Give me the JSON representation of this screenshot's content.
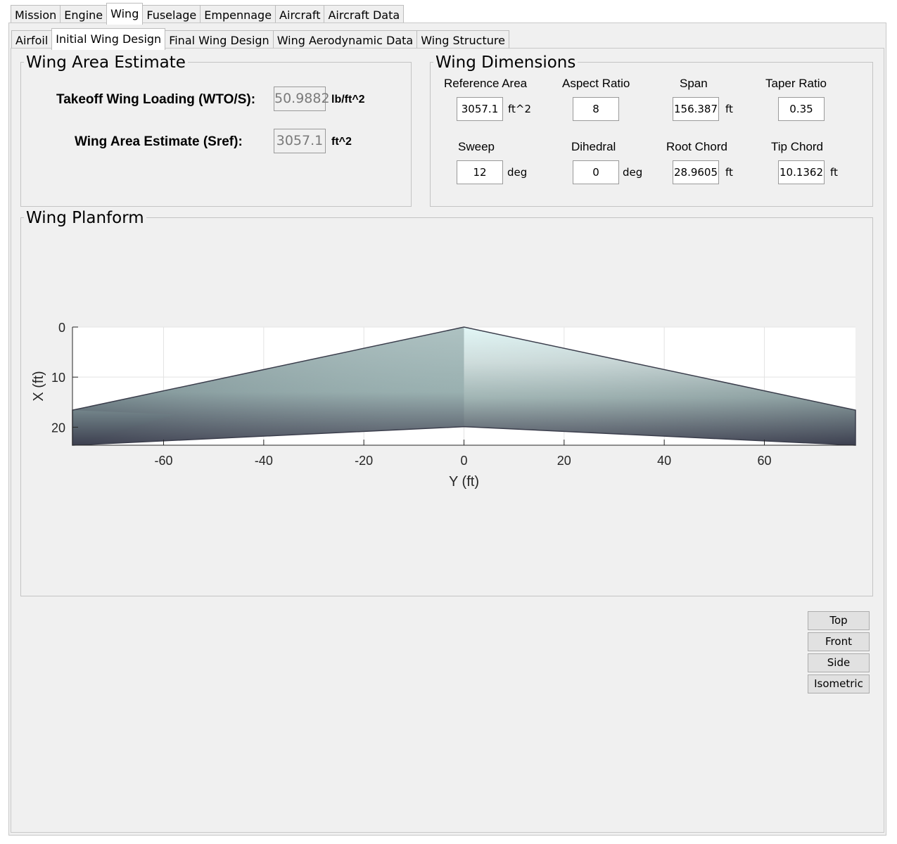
{
  "main_tabs": [
    "Mission",
    "Engine",
    "Wing",
    "Fuselage",
    "Empennage",
    "Aircraft",
    "Aircraft Data"
  ],
  "main_active": "Wing",
  "sub_tabs": [
    "Airfoil",
    "Initial Wing Design",
    "Final Wing Design",
    "Wing Aerodynamic Data",
    "Wing Structure"
  ],
  "sub_active": "Initial Wing Design",
  "area_estimate": {
    "title": "Wing Area Estimate",
    "loading_label": "Takeoff Wing Loading (WTO/S):",
    "loading_value": "50.9882",
    "loading_unit": "lb/ft^2",
    "sref_label": "Wing Area Estimate (Sref):",
    "sref_value": "3057.1",
    "sref_unit": "ft^2"
  },
  "dimensions": {
    "title": "Wing Dimensions",
    "reference_area": {
      "label": "Reference Area",
      "value": "3057.1",
      "unit": "ft^2"
    },
    "aspect_ratio": {
      "label": "Aspect Ratio",
      "value": "8"
    },
    "span": {
      "label": "Span",
      "value": "156.387",
      "unit": "ft"
    },
    "taper_ratio": {
      "label": "Taper Ratio",
      "value": "0.35"
    },
    "sweep": {
      "label": "Sweep",
      "value": "12",
      "unit": "deg"
    },
    "dihedral": {
      "label": "Dihedral",
      "value": "0",
      "unit": "deg"
    },
    "root_chord": {
      "label": "Root Chord",
      "value": "28.9605",
      "unit": "ft"
    },
    "tip_chord": {
      "label": "Tip Chord",
      "value": "10.1362",
      "unit": "ft"
    }
  },
  "planform": {
    "title": "Wing Planform"
  },
  "view_buttons": {
    "top": "Top",
    "front": "Front",
    "side": "Side",
    "isometric": "Isometric"
  },
  "chart_data": {
    "type": "area",
    "title": "",
    "xlabel": "Y (ft)",
    "ylabel": "X (ft)",
    "xlim": [
      -78.2,
      78.2
    ],
    "ylim": [
      0,
      23.6
    ],
    "y_reversed": true,
    "grid": true,
    "xticks": [
      -60,
      -40,
      -20,
      0,
      20,
      40,
      60
    ],
    "yticks": [
      0,
      10,
      20
    ],
    "xtick_labels": [
      "-60",
      "-40",
      "-20",
      "0",
      "20",
      "40",
      "60"
    ],
    "ytick_labels": [
      "0",
      "10",
      "20"
    ],
    "leading_edge": {
      "x": [
        -78.2,
        0,
        78.2
      ],
      "y": [
        16.6,
        0,
        16.6
      ]
    },
    "trailing_edge": {
      "x": [
        -78.2,
        0,
        78.2
      ],
      "y": [
        23.6,
        19.9,
        23.6
      ]
    },
    "colors": {
      "top_tint": "#dff6f6",
      "bottom": "#3c3f4f",
      "mid": "#8fa8a8"
    }
  }
}
